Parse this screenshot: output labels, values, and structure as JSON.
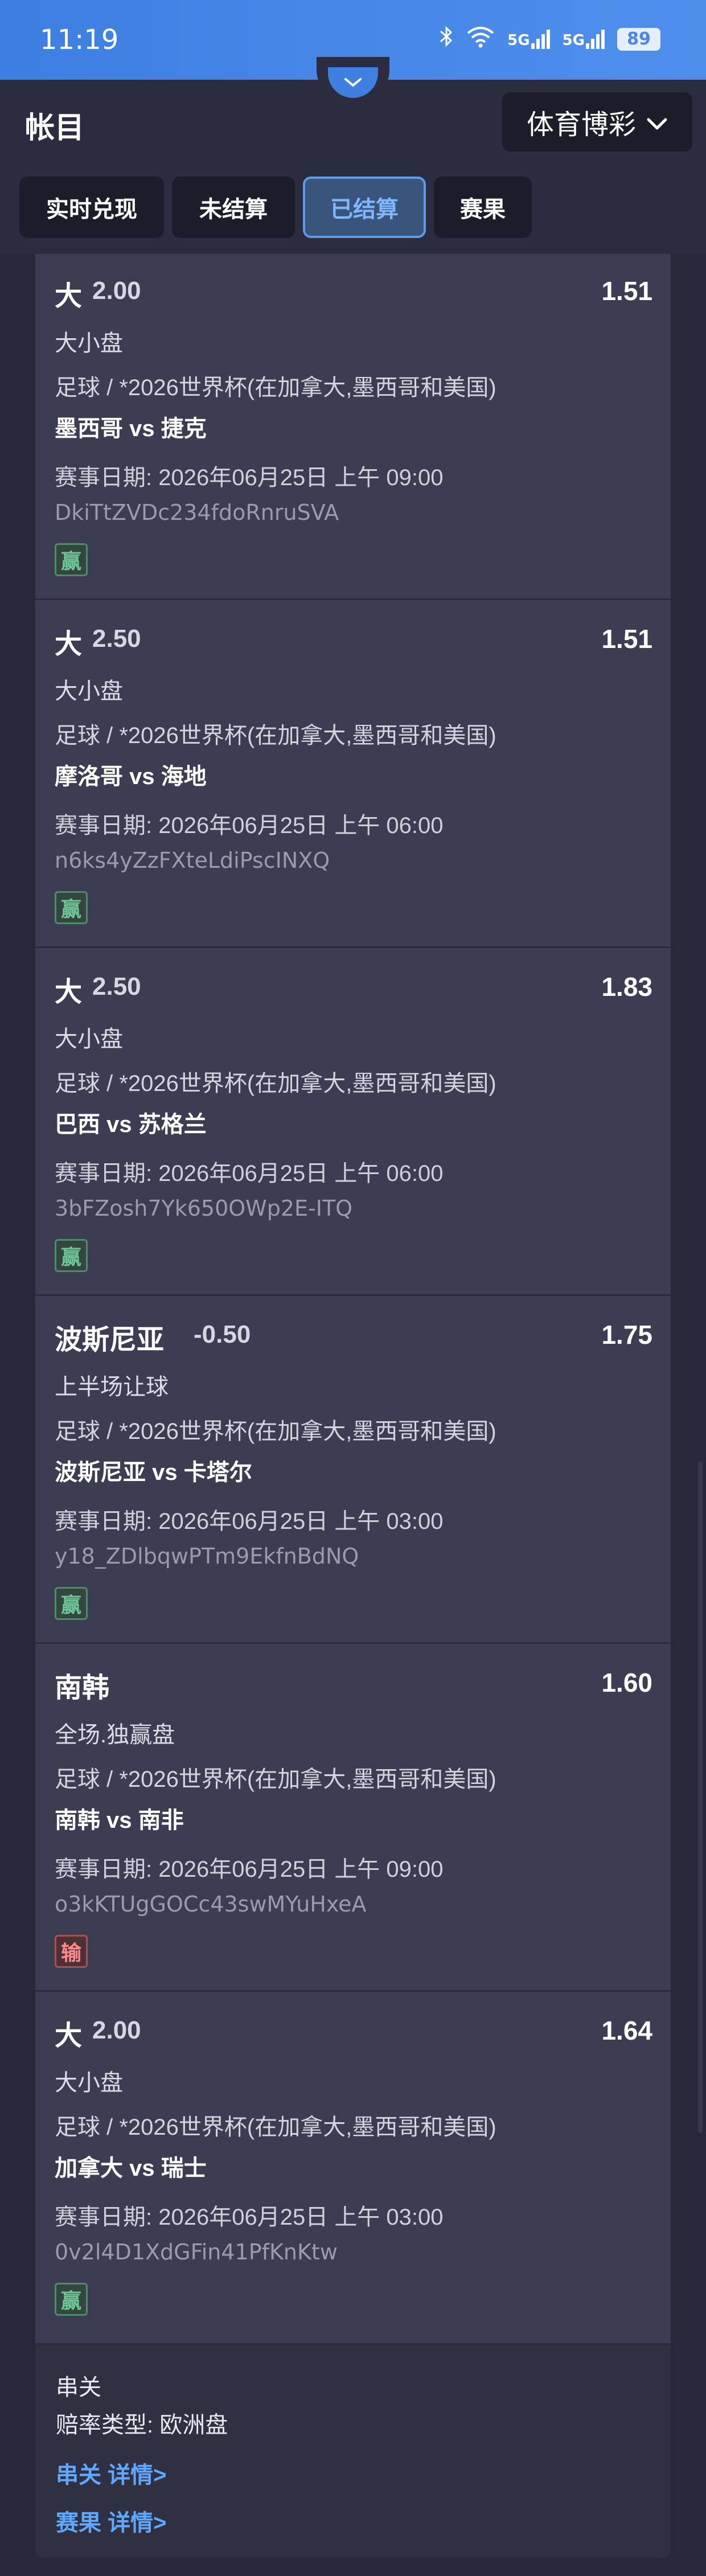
{
  "status": {
    "time": "11:19",
    "battery": "89",
    "network_1": "5G",
    "network_2": "5G"
  },
  "header": {
    "title": "帐目",
    "sport_select": "体育博彩"
  },
  "tabs": [
    {
      "label": "实时兑现",
      "active": false
    },
    {
      "label": "未结算",
      "active": false
    },
    {
      "label": "已结算",
      "active": true
    },
    {
      "label": "赛果",
      "active": false
    }
  ],
  "bets": [
    {
      "pick": "大",
      "line": "2.00",
      "odds": "1.51",
      "market": "大小盘",
      "league": "足球 / *2026世界杯(在加拿大,墨西哥和美国)",
      "teams": "墨西哥 vs 捷克",
      "date": "赛事日期: 2026年06月25日 上午 09:00",
      "code": "DkiTtZVDc234fdoRnruSVA",
      "result": "赢"
    },
    {
      "pick": "大",
      "line": "2.50",
      "odds": "1.51",
      "market": "大小盘",
      "league": "足球 / *2026世界杯(在加拿大,墨西哥和美国)",
      "teams": "摩洛哥 vs 海地",
      "date": "赛事日期: 2026年06月25日 上午 06:00",
      "code": "n6ks4yZzFXteLdiPscINXQ",
      "result": "赢"
    },
    {
      "pick": "大",
      "line": "2.50",
      "odds": "1.83",
      "market": "大小盘",
      "league": "足球 / *2026世界杯(在加拿大,墨西哥和美国)",
      "teams": "巴西 vs 苏格兰",
      "date": "赛事日期: 2026年06月25日 上午 06:00",
      "code": "3bFZosh7Yk650OWp2E-ITQ",
      "result": "赢"
    },
    {
      "pick": "波斯尼亚",
      "line": "-0.50",
      "odds": "1.75",
      "market": "上半场让球",
      "league": "足球 / *2026世界杯(在加拿大,墨西哥和美国)",
      "teams": "波斯尼亚 vs 卡塔尔",
      "date": "赛事日期: 2026年06月25日 上午 03:00",
      "code": "y18_ZDlbqwPTm9EkfnBdNQ",
      "result": "赢"
    },
    {
      "pick": "南韩",
      "line": "",
      "odds": "1.60",
      "market": "全场.独赢盘",
      "league": "足球 / *2026世界杯(在加拿大,墨西哥和美国)",
      "teams": "南韩 vs 南非",
      "date": "赛事日期: 2026年06月25日 上午 09:00",
      "code": "o3kKTUgGOCc43swMYuHxeA",
      "result": "输"
    },
    {
      "pick": "大",
      "line": "2.00",
      "odds": "1.64",
      "market": "大小盘",
      "league": "足球 / *2026世界杯(在加拿大,墨西哥和美国)",
      "teams": "加拿大 vs 瑞士",
      "date": "赛事日期: 2026年06月25日 上午 03:00",
      "code": "0v2l4D1XdGFin41PfKnKtw",
      "result": "赢"
    }
  ],
  "summary": {
    "title": "串关",
    "odds_type": "赔率类型: 欧洲盘",
    "parlay_link": "串关 详情>",
    "results_link": "赛果 详情>"
  },
  "colors": {
    "accent": "#5ea9ff",
    "win": "#6fc597",
    "lose": "#ff8a8a",
    "status_bar": "#4a86e8"
  }
}
